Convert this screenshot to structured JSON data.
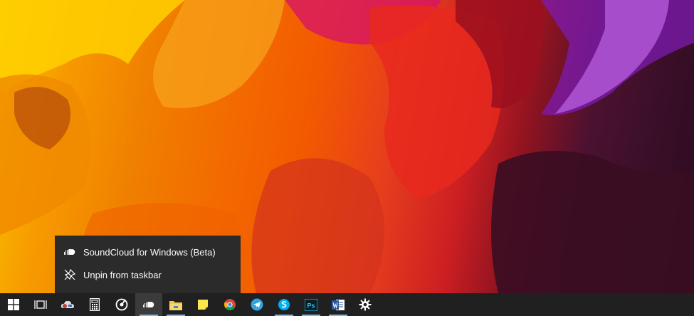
{
  "jumplist": {
    "items": [
      {
        "label": "SoundCloud for Windows (Beta)",
        "icon": "soundcloud-icon"
      },
      {
        "label": "Unpin from taskbar",
        "icon": "unpin-icon"
      }
    ]
  },
  "taskbar": {
    "buttons": [
      {
        "name": "start",
        "icon": "windows-logo-icon"
      },
      {
        "name": "task-view",
        "icon": "task-view-icon"
      },
      {
        "name": "app-1",
        "icon": "cloud-app-icon"
      },
      {
        "name": "calculator",
        "icon": "calculator-icon"
      },
      {
        "name": "groove-music",
        "icon": "groove-icon"
      },
      {
        "name": "soundcloud",
        "icon": "soundcloud-icon",
        "active": true
      },
      {
        "name": "file-explorer",
        "icon": "folder-icon"
      },
      {
        "name": "sticky-notes",
        "icon": "sticky-note-icon"
      },
      {
        "name": "chrome",
        "icon": "chrome-icon"
      },
      {
        "name": "telegram",
        "icon": "telegram-icon"
      },
      {
        "name": "skype",
        "icon": "skype-icon"
      },
      {
        "name": "photoshop",
        "icon": "photoshop-icon",
        "text": "Ps"
      },
      {
        "name": "word",
        "icon": "word-icon"
      },
      {
        "name": "settings",
        "icon": "gear-icon"
      }
    ]
  },
  "colors": {
    "taskbar": "#202020",
    "jumplist": "#2b2b2b",
    "accent_underline": "#7cb7e8"
  }
}
